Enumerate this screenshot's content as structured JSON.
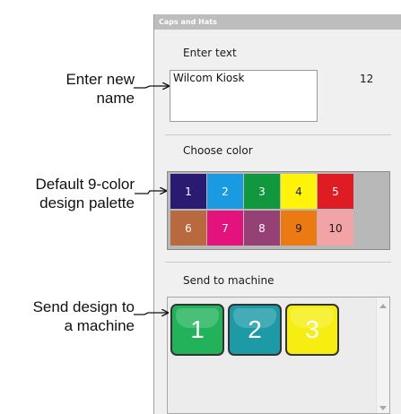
{
  "callouts": {
    "enter_name": [
      "Enter new",
      "name"
    ],
    "palette": [
      "Default 9-color",
      "design palette"
    ],
    "send": [
      "Send design to",
      "a machine"
    ]
  },
  "panel": {
    "title": "Caps and Hats",
    "enter_text_label": "Enter text",
    "text_value": "Wilcom Kiosk",
    "char_count": "12",
    "choose_color_label": "Choose color",
    "send_label": "Send to machine"
  },
  "palette": [
    {
      "label": "1",
      "color": "#2b1a72",
      "text_color": "#ffffff"
    },
    {
      "label": "2",
      "color": "#1a9ae0",
      "text_color": "#ffffff"
    },
    {
      "label": "3",
      "color": "#11973e",
      "text_color": "#ffffff"
    },
    {
      "label": "4",
      "color": "#fff30a",
      "text_color": "#1a1a1a"
    },
    {
      "label": "5",
      "color": "#df1c24",
      "text_color": "#ffffff"
    },
    {
      "label": "6",
      "color": "#b86a3e",
      "text_color": "#ffffff"
    },
    {
      "label": "7",
      "color": "#e4127c",
      "text_color": "#ffffff"
    },
    {
      "label": "8",
      "color": "#954175",
      "text_color": "#ffffff"
    },
    {
      "label": "9",
      "color": "#ec7a12",
      "text_color": "#1a1a1a"
    },
    {
      "label": "10",
      "color": "#f2a3a6",
      "text_color": "#1a1a1a"
    }
  ],
  "machines": [
    {
      "label": "1",
      "color": "#22b35a"
    },
    {
      "label": "2",
      "color": "#1c9aa6"
    },
    {
      "label": "3",
      "color": "#f5ee10"
    }
  ]
}
